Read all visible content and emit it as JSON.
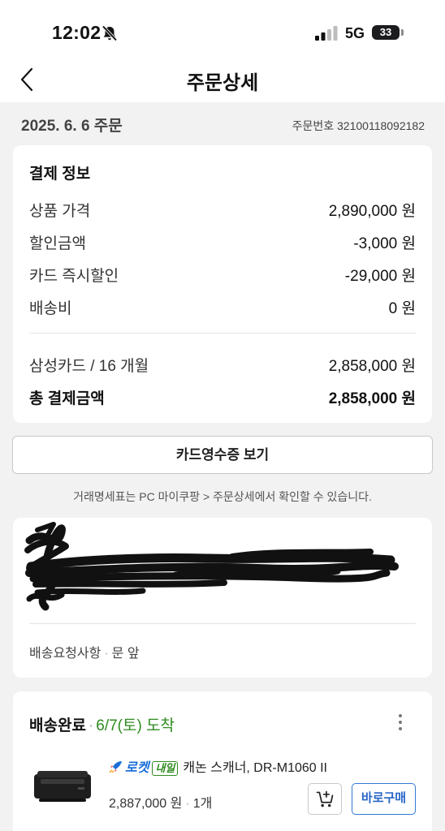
{
  "status_bar": {
    "time": "12:02",
    "network": "5G",
    "battery": "33"
  },
  "nav": {
    "title": "주문상세"
  },
  "order": {
    "date": "2025. 6. 6 주문",
    "number": "주문번호 32100118092182"
  },
  "payment": {
    "heading": "결제 정보",
    "rows": [
      {
        "label": "상품 가격",
        "value": "2,890,000 원"
      },
      {
        "label": "할인금액",
        "value": "-3,000 원"
      },
      {
        "label": "카드 즉시할인",
        "value": "-29,000 원"
      },
      {
        "label": "배송비",
        "value": "0 원"
      }
    ],
    "card_row": {
      "label": "삼성카드 / 16 개월",
      "value": "2,858,000 원"
    },
    "total_row": {
      "label": "총 결제금액",
      "value": "2,858,000 원"
    }
  },
  "receipt_button": "카드영수증 보기",
  "info_note": "거래명세표는 PC 마이쿠팡 > 주문상세에서 확인할 수 있습니다.",
  "delivery": {
    "request_label": "배송요청사항",
    "request_value": "문 앞"
  },
  "shipping": {
    "status": "배송완료",
    "arrival": "6/7(토) 도착",
    "product": {
      "rocket_label": "로켓",
      "tomorrow_badge": "내일",
      "name": "캐논 스캐너, DR-M1060 II",
      "price": "2,887,000 원",
      "quantity": "1개"
    },
    "buy_again": "바로구매"
  },
  "colors": {
    "arrival_green": "#2e8b1f",
    "buy_again_blue": "#2866c8",
    "rocket_blue": "#1a6fd9"
  }
}
